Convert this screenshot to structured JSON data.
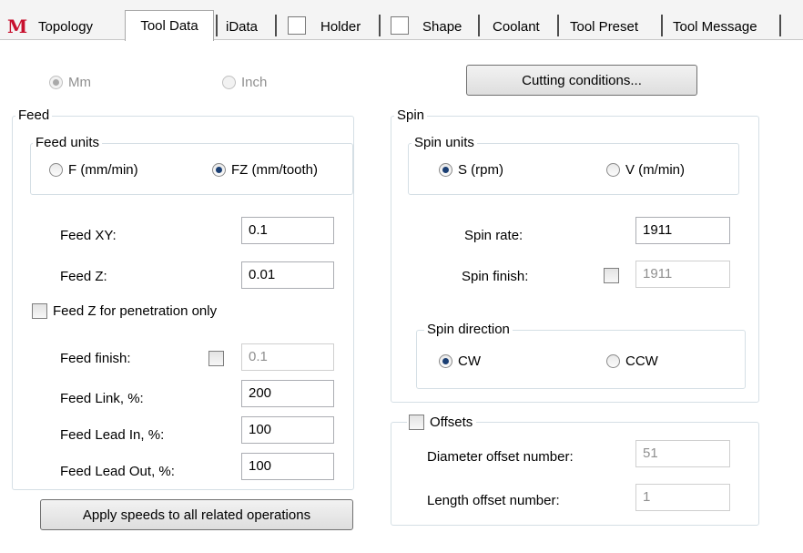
{
  "tabs": {
    "logo": "M",
    "items": [
      "Topology",
      "Tool Data",
      "iData",
      "Holder",
      "Shape",
      "Coolant",
      "Tool Preset",
      "Tool Message"
    ]
  },
  "units": {
    "mm_label": "Mm",
    "inch_label": "Inch",
    "selected": "Mm"
  },
  "cutting_conditions_label": "Cutting conditions...",
  "feed": {
    "title": "Feed",
    "units_title": "Feed units",
    "unit_f_label": "F (mm/min)",
    "unit_fz_label": "FZ (mm/tooth)",
    "selected_unit": "FZ (mm/tooth)",
    "xy_label": "Feed XY:",
    "xy_value": "0.1",
    "z_label": "Feed Z:",
    "z_value": "0.01",
    "penetration_label": "Feed Z for penetration only",
    "finish_label": "Feed finish:",
    "finish_value": "0.1",
    "link_label": "Feed Link, %:",
    "link_value": "200",
    "lead_in_label": "Feed Lead In, %:",
    "lead_in_value": "100",
    "lead_out_label": "Feed Lead Out, %:",
    "lead_out_value": "100"
  },
  "spin": {
    "title": "Spin",
    "units_title": "Spin units",
    "unit_s_label": "S (rpm)",
    "unit_v_label": "V (m/min)",
    "selected_unit": "S (rpm)",
    "rate_label": "Spin rate:",
    "rate_value": "1911",
    "finish_label": "Spin finish:",
    "finish_value": "1911",
    "direction_title": "Spin direction",
    "cw_label": "CW",
    "ccw_label": "CCW",
    "selected_direction": "CW"
  },
  "offsets": {
    "title": "Offsets",
    "diameter_label": "Diameter offset number:",
    "diameter_value": "51",
    "length_label": "Length offset number:",
    "length_value": "1"
  },
  "apply_label": "Apply speeds to all related operations",
  "colors": {
    "logo_red": "#c8102e",
    "group_border": "#d5dfe5",
    "radio_dot": "#1b3f73"
  }
}
